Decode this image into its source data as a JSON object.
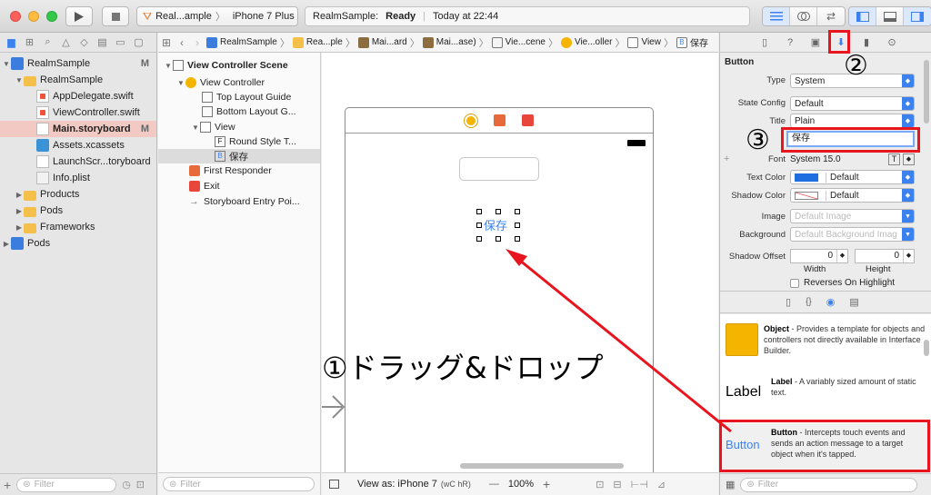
{
  "toolbar": {
    "scheme_project": "Real...ample",
    "scheme_device": "iPhone 7 Plus",
    "status_app": "RealmSample:",
    "status_state": "Ready",
    "status_time": "Today at 22:44"
  },
  "navigator": {
    "items": [
      {
        "label": "RealmSample",
        "badge": "M"
      },
      {
        "label": "RealmSample",
        "badge": ""
      },
      {
        "label": "AppDelegate.swift",
        "badge": ""
      },
      {
        "label": "ViewController.swift",
        "badge": ""
      },
      {
        "label": "Main.storyboard",
        "badge": "M"
      },
      {
        "label": "Assets.xcassets",
        "badge": ""
      },
      {
        "label": "LaunchScr...toryboard",
        "badge": ""
      },
      {
        "label": "Info.plist",
        "badge": ""
      },
      {
        "label": "Products",
        "badge": ""
      },
      {
        "label": "Pods",
        "badge": ""
      },
      {
        "label": "Frameworks",
        "badge": ""
      },
      {
        "label": "Pods",
        "badge": ""
      }
    ],
    "filter_placeholder": "Filter"
  },
  "jumpbar": {
    "crumbs": [
      "RealmSample",
      "Rea...ple",
      "Mai...ard",
      "Mai...ase)",
      "Vie...cene",
      "Vie...oller",
      "View",
      "保存"
    ]
  },
  "outline": {
    "scene": "View Controller Scene",
    "items": [
      "View Controller",
      "Top Layout Guide",
      "Bottom Layout G...",
      "View",
      "Round Style T...",
      "保存",
      "First Responder",
      "Exit",
      "Storyboard Entry Poi..."
    ],
    "item_letters": [
      "F",
      "B"
    ],
    "filter_placeholder": "Filter"
  },
  "canvas": {
    "button_title": "保存",
    "annotation_drag": "①ドラッグ&ドロップ",
    "view_as": "View as: iPhone 7",
    "size_class": "(wC hR)",
    "zoom": "100%",
    "zoom_minus": "—",
    "zoom_plus": "+"
  },
  "inspector": {
    "section": "Button",
    "type_label": "Type",
    "type_value": "System",
    "state_label": "State Config",
    "state_value": "Default",
    "title_label": "Title",
    "title_value": "Plain",
    "title_text": "保存",
    "font_label": "Font",
    "font_value": "System 15.0",
    "textcolor_label": "Text Color",
    "textcolor_value": "Default",
    "shadowcolor_label": "Shadow Color",
    "shadowcolor_value": "Default",
    "image_label": "Image",
    "image_placeholder": "Default Image",
    "bg_label": "Background",
    "bg_placeholder": "Default Background Imag",
    "shadow_offset_label": "Shadow Offset",
    "shadow_w": "0",
    "shadow_h": "0",
    "width_label": "Width",
    "height_label": "Height",
    "reverses_label": "Reverses On Highlight",
    "annotation_2": "②",
    "annotation_3": "③",
    "filter_placeholder": "Filter"
  },
  "library": {
    "items": [
      {
        "name": "Object",
        "desc": " - Provides a template for objects and controllers not directly available in Interface Builder."
      },
      {
        "name": "Label",
        "desc": " - A variably sized amount of static text.",
        "preview": "Label"
      },
      {
        "name": "Button",
        "desc": " - Intercepts touch events and sends an action message to a target object when it's tapped.",
        "preview": "Button"
      }
    ]
  },
  "colors": {
    "accent": "#3b82f0",
    "annotation_red": "#e8141e",
    "selection": "#dcdcdc",
    "nav_selected": "#f2c9c3"
  }
}
